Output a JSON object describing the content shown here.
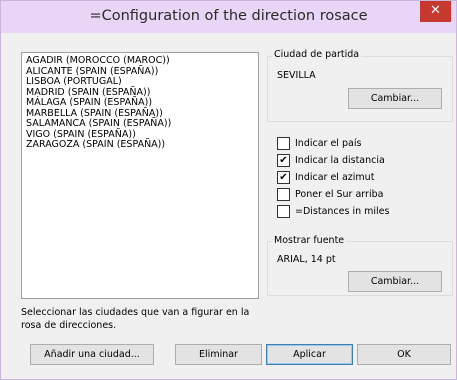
{
  "window": {
    "title": "=Configuration of the direction rosace",
    "close_glyph": "✕"
  },
  "cities": {
    "items": [
      "AGADIR (MOROCCO (MAROC))",
      "ALICANTE (SPAIN (ESPAÑA))",
      "LISBOA (PORTUGAL)",
      "MADRID (SPAIN (ESPAÑA))",
      "MÁLAGA (SPAIN (ESPAÑA))",
      "MARBELLA (SPAIN (ESPAÑA))",
      "SALAMANCA (SPAIN (ESPAÑA))",
      "VIGO (SPAIN (ESPAÑA))",
      "ZARAGOZA (SPAIN (ESPAÑA))"
    ],
    "hint": "Seleccionar las ciudades que van a figurar en la rosa de direcciones."
  },
  "departure": {
    "group_label": "Ciudad de partida",
    "value": "SEVILLA",
    "change_label": "Cambiar..."
  },
  "options": [
    {
      "label": "Indicar el país",
      "checked": false
    },
    {
      "label": "Indicar la distancia",
      "checked": true
    },
    {
      "label": "Indicar el azimut",
      "checked": true
    },
    {
      "label": "Poner el Sur arriba",
      "checked": false
    },
    {
      "label": "=Distances in miles",
      "checked": false
    }
  ],
  "font": {
    "group_label": "Mostrar fuente",
    "value": "ARIAL, 14 pt",
    "change_label": "Cambiar..."
  },
  "buttons": {
    "add_city": "Añadir una ciudad...",
    "remove": "Eliminar",
    "apply": "Aplicar",
    "ok": "OK"
  },
  "colors": {
    "titlebar": "#e9d6f6",
    "close": "#c7392f",
    "dialog_bg": "#f0f0f0"
  }
}
